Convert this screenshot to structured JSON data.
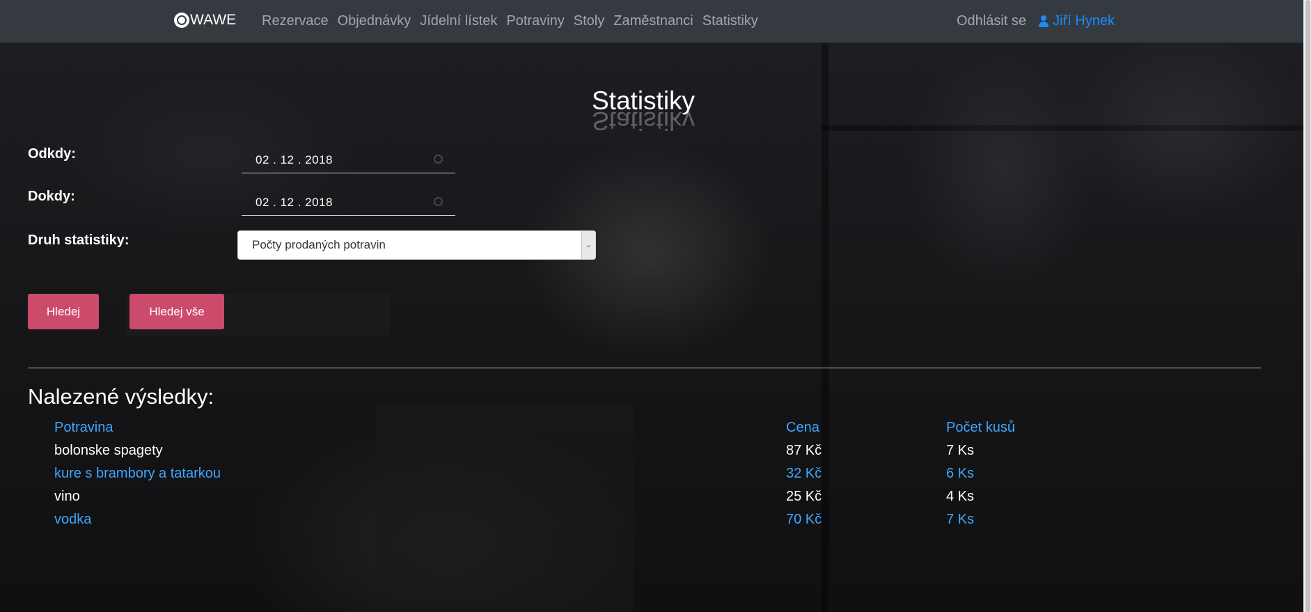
{
  "brand": {
    "name": "WAWE"
  },
  "nav": {
    "links": [
      "Rezervace",
      "Objednávky",
      "Jídelní lístek",
      "Potraviny",
      "Stoly",
      "Zaměstnanci",
      "Statistiky"
    ],
    "logout": "Odhlásit se",
    "user": "Jiří Hynek"
  },
  "page": {
    "title": "Statistiky"
  },
  "form": {
    "from_label": "Odkdy:",
    "from_value": "02 . 12 . 2018",
    "to_label": "Dokdy:",
    "to_value": "02 . 12 . 2018",
    "type_label": "Druh statistiky:",
    "type_value": "Počty prodaných potravin",
    "search_button": "Hledej",
    "search_all_button": "Hledej vše"
  },
  "results": {
    "title": "Nalezené výsledky:",
    "headers": [
      "Potravina",
      "Cena",
      "Počet kusů"
    ],
    "rows": [
      [
        "bolonske spagety",
        "87 Kč",
        "7 Ks"
      ],
      [
        "kure s brambory a tatarkou",
        "32 Kč",
        "6 Ks"
      ],
      [
        "vino",
        "25 Kč",
        "4 Ks"
      ],
      [
        "vodka",
        "70 Kč",
        "7 Ks"
      ]
    ]
  },
  "colors": {
    "navbar": "#343a40",
    "link_blue": "#3fa6ff",
    "button": "#cc4a6a",
    "user_blue": "#1a8cff"
  },
  "icons": {
    "brand": "circle-logo-icon",
    "user": "user-icon",
    "calendar": "calendar-icon",
    "dropdown": "chevron-down-icon"
  }
}
